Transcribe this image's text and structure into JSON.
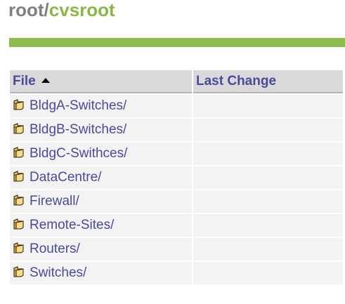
{
  "breadcrumb": {
    "root": "root",
    "separator": "/",
    "current": "cvsroot"
  },
  "table": {
    "columns": {
      "file": "File",
      "last_change": "Last Change"
    },
    "sort": "ascending",
    "rows": [
      {
        "name": "BldgA-Switches/",
        "last_change": "",
        "icon": "folder-icon"
      },
      {
        "name": "BldgB-Switches/",
        "last_change": "",
        "icon": "folder-icon"
      },
      {
        "name": "BldgC-Swithces/",
        "last_change": "",
        "icon": "folder-icon"
      },
      {
        "name": "DataCentre/",
        "last_change": "",
        "icon": "folder-icon"
      },
      {
        "name": "Firewall/",
        "last_change": "",
        "icon": "folder-icon"
      },
      {
        "name": "Remote-Sites/",
        "last_change": "",
        "icon": "folder-icon"
      },
      {
        "name": "Routers/",
        "last_change": "",
        "icon": "folder-icon"
      },
      {
        "name": "Switches/",
        "last_change": "",
        "icon": "folder-icon"
      }
    ]
  },
  "colors": {
    "accent_green": "#8cbc4c",
    "link_blue": "#4a4a9c",
    "crumb_gray": "#808080"
  }
}
